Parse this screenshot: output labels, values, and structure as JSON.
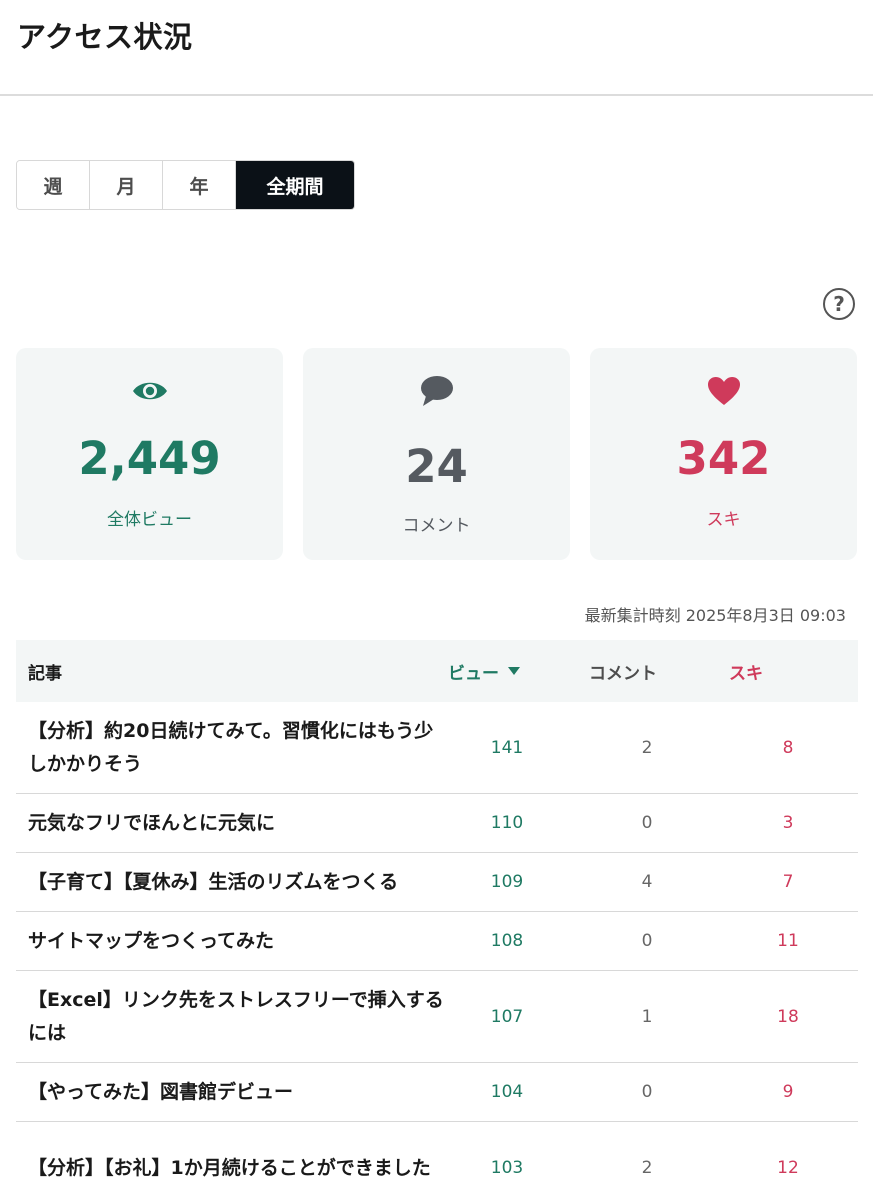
{
  "page": {
    "title": "アクセス状況"
  },
  "period_tabs": [
    {
      "label": "週",
      "active": false
    },
    {
      "label": "月",
      "active": false
    },
    {
      "label": "年",
      "active": false
    },
    {
      "label": "全期間",
      "active": true
    }
  ],
  "help": {
    "icon": "question-circle-icon",
    "glyph": "?"
  },
  "stats": {
    "views": {
      "value": "2,449",
      "label": "全体ビュー",
      "icon": "eye-icon",
      "color": "#1f7a63"
    },
    "comments": {
      "value": "24",
      "label": "コメント",
      "icon": "speech-bubble-icon",
      "color": "#555a60"
    },
    "likes": {
      "value": "342",
      "label": "スキ",
      "icon": "heart-icon",
      "color": "#cf3a5b"
    }
  },
  "updated_at": "最新集計時刻 2025年8月3日 09:03",
  "table": {
    "headers": {
      "article": "記事",
      "views": "ビュー",
      "comments": "コメント",
      "likes": "スキ"
    },
    "rows": [
      {
        "title": "【分析】約20日続けてみて。習慣化にはもう少しかかりそう",
        "views": "141",
        "comments": "2",
        "likes": "8"
      },
      {
        "title": "元気なフリでほんとに元気に",
        "views": "110",
        "comments": "0",
        "likes": "3"
      },
      {
        "title": "【子育て】【夏休み】生活のリズムをつくる",
        "views": "109",
        "comments": "4",
        "likes": "7"
      },
      {
        "title": "サイトマップをつくってみた",
        "views": "108",
        "comments": "0",
        "likes": "11"
      },
      {
        "title": "【Excel】リンク先をストレスフリーで挿入するには",
        "views": "107",
        "comments": "1",
        "likes": "18"
      },
      {
        "title": "【やってみた】図書館デビュー",
        "views": "104",
        "comments": "0",
        "likes": "9"
      },
      {
        "title": "【分析】【お礼】1か月続けることができました",
        "views": "103",
        "comments": "2",
        "likes": "12"
      }
    ]
  }
}
